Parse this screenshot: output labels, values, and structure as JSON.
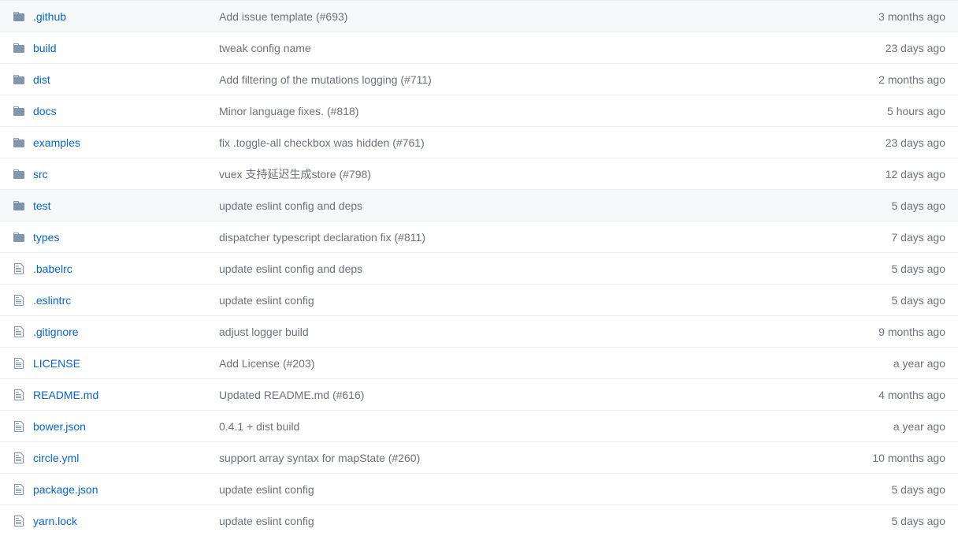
{
  "files": [
    {
      "type": "folder",
      "name": ".github",
      "message": "Add issue template (#693)",
      "time": "3 months ago"
    },
    {
      "type": "folder",
      "name": "build",
      "message": "tweak config name",
      "time": "23 days ago"
    },
    {
      "type": "folder",
      "name": "dist",
      "message": "Add filtering of the mutations logging (#711)",
      "time": "2 months ago"
    },
    {
      "type": "folder",
      "name": "docs",
      "message": "Minor language fixes. (#818)",
      "time": "5 hours ago"
    },
    {
      "type": "folder",
      "name": "examples",
      "message": "fix .toggle-all checkbox was hidden (#761)",
      "time": "23 days ago"
    },
    {
      "type": "folder",
      "name": "src",
      "message": "vuex 支持延迟生成store (#798)",
      "time": "12 days ago"
    },
    {
      "type": "folder",
      "name": "test",
      "message": "update eslint config and deps",
      "time": "5 days ago",
      "hovered": true
    },
    {
      "type": "folder",
      "name": "types",
      "message": "dispatcher typescript declaration fix (#811)",
      "time": "7 days ago"
    },
    {
      "type": "file",
      "name": ".babelrc",
      "message": "update eslint config and deps",
      "time": "5 days ago"
    },
    {
      "type": "file",
      "name": ".eslintrc",
      "message": "update eslint config",
      "time": "5 days ago"
    },
    {
      "type": "file",
      "name": ".gitignore",
      "message": "adjust logger build",
      "time": "9 months ago"
    },
    {
      "type": "file",
      "name": "LICENSE",
      "message": "Add License (#203)",
      "time": "a year ago"
    },
    {
      "type": "file",
      "name": "README.md",
      "message": "Updated README.md (#616)",
      "time": "4 months ago"
    },
    {
      "type": "file",
      "name": "bower.json",
      "message": "0.4.1 + dist build",
      "time": "a year ago"
    },
    {
      "type": "file",
      "name": "circle.yml",
      "message": "support array syntax for mapState (#260)",
      "time": "10 months ago"
    },
    {
      "type": "file",
      "name": "package.json",
      "message": "update eslint config",
      "time": "5 days ago"
    },
    {
      "type": "file",
      "name": "yarn.lock",
      "message": "update eslint config",
      "time": "5 days ago"
    }
  ]
}
